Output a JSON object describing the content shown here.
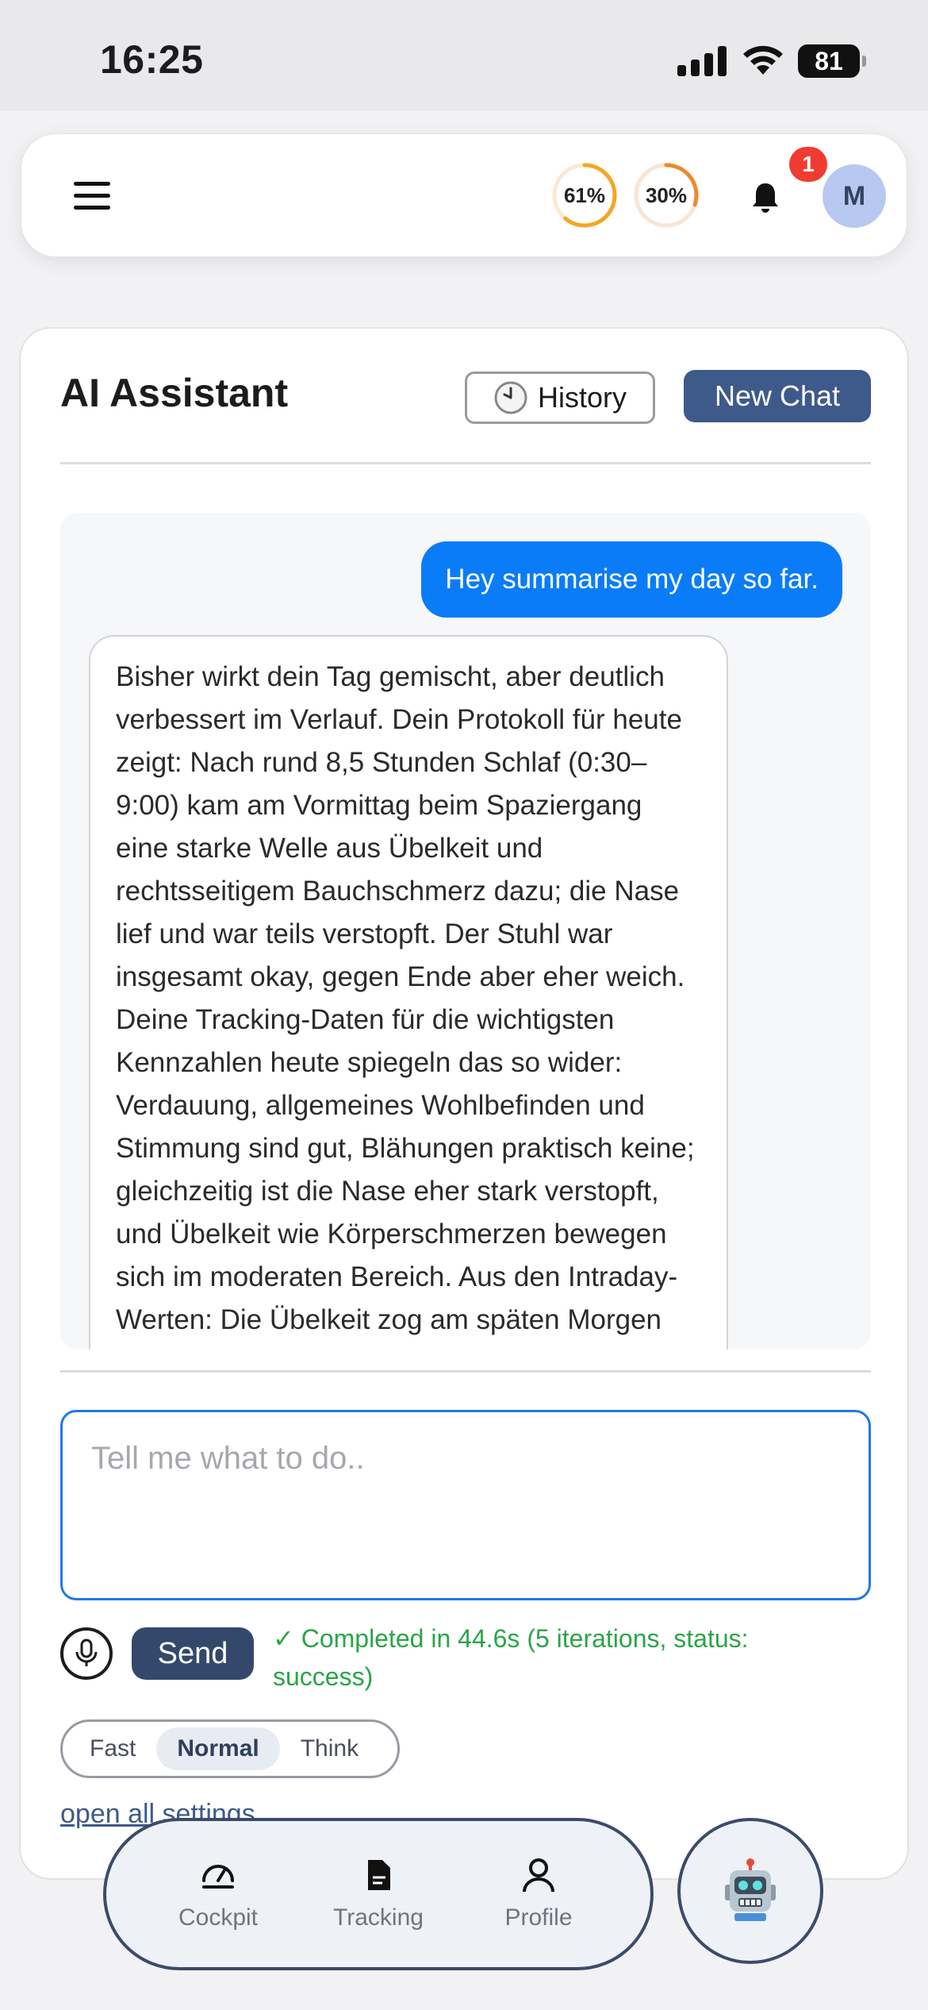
{
  "status_bar": {
    "time": "16:25",
    "battery": "81"
  },
  "header": {
    "ring_1": {
      "label": "61%",
      "value": 0.61,
      "color": "#f5a623"
    },
    "ring_2": {
      "label": "30%",
      "value": 0.3,
      "color": "#f0882a"
    },
    "notification_count": "1",
    "avatar_initial": "M"
  },
  "assistant": {
    "title": "AI Assistant",
    "history_label": "History",
    "new_chat_label": "New Chat"
  },
  "chat": {
    "messages": [
      {
        "role": "user",
        "text": "Hey summarise my day so far."
      },
      {
        "role": "assistant",
        "text": "Bisher wirkt dein Tag gemischt, aber deutlich verbessert im Verlauf. Dein Protokoll für heute zeigt: Nach rund 8,5 Stunden Schlaf (0:30–9:00) kam am Vormittag beim Spaziergang eine starke Welle aus Übelkeit und rechtsseitigem Bauchschmerz dazu; die Nase lief und war teils verstopft. Der Stuhl war insgesamt okay, gegen Ende aber eher weich. Deine Tracking-Daten für die wichtigsten Kennzahlen heute spiegeln das so wider: Verdauung, allgemeines Wohlbefinden und Stimmung sind gut, Blähungen praktisch keine; gleichzeitig ist die Nase eher stark verstopft, und Übelkeit wie Körperschmerzen bewegen sich im moderaten Bereich. Aus den Intraday-Werten: Die Übelkeit zog am späten Morgen kurz bis stark/sehr stark an und fiel"
      }
    ]
  },
  "composer": {
    "placeholder": "Tell me what to do..",
    "send_label": "Send",
    "status": "✓ Completed in 44.6s (5 iterations, status: success)",
    "modes": [
      "Fast",
      "Normal",
      "Think"
    ],
    "active_mode": "Normal",
    "settings_link": "open all settings"
  },
  "nav": {
    "items": [
      {
        "label": "Cockpit",
        "icon": "gauge-icon"
      },
      {
        "label": "Tracking",
        "icon": "document-icon"
      },
      {
        "label": "Profile",
        "icon": "person-icon"
      }
    ],
    "assistant_icon": "robot-icon"
  },
  "colors": {
    "accent": "#3e5a8a",
    "user_bubble": "#0a7cf7",
    "success": "#2aa548",
    "badge": "#f23b30"
  }
}
